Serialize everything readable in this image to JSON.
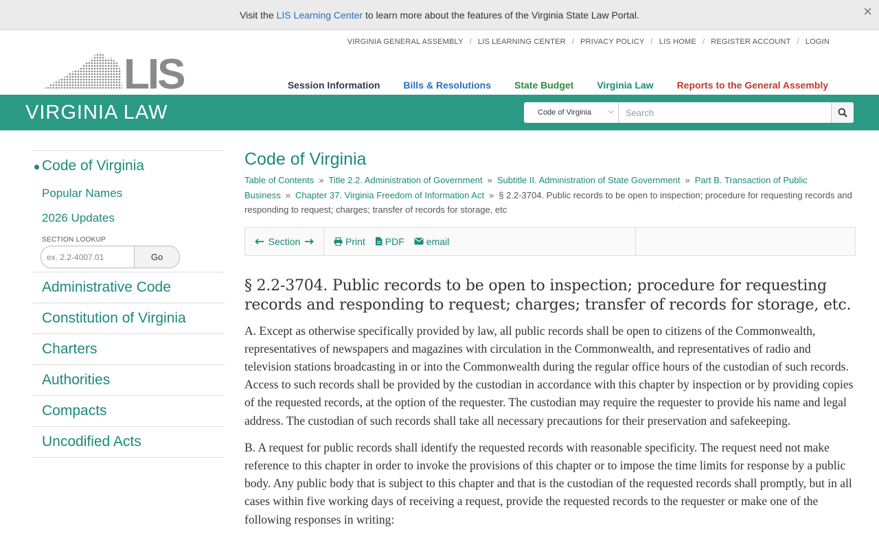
{
  "notice": {
    "prefix": "Visit the",
    "link": "LIS Learning Center",
    "suffix": "to learn more about the features of the Virginia State Law Portal.",
    "close": "×"
  },
  "topnav": [
    "VIRGINIA GENERAL ASSEMBLY",
    "LIS LEARNING CENTER",
    "PRIVACY POLICY",
    "LIS HOME",
    "REGISTER ACCOUNT",
    "LOGIN"
  ],
  "mainnav": {
    "session": "Session Information",
    "bills": "Bills & Resolutions",
    "budget": "State Budget",
    "vlaw": "Virginia Law",
    "reports": "Reports to the General Assembly"
  },
  "banner": {
    "title": "VIRGINIA LAW",
    "select_value": "Code of Virginia",
    "search_placeholder": "Search"
  },
  "sidebar": {
    "active": "Code of Virginia",
    "sub": [
      "Popular Names",
      "2026 Updates"
    ],
    "lookup_label": "SECTION LOOKUP",
    "lookup_placeholder": "ex. 2.2-4007.01",
    "lookup_go": "Go",
    "items": [
      "Administrative Code",
      "Constitution of Virginia",
      "Charters",
      "Authorities",
      "Compacts",
      "Uncodified Acts"
    ]
  },
  "content": {
    "title": "Code of Virginia",
    "breadcrumbs": [
      "Table of Contents",
      "Title 2.2. Administration of Government",
      "Subtitle II. Administration of State Government",
      "Part B. Transaction of Public Business",
      "Chapter 37. Virginia Freedom of Information Act"
    ],
    "current_crumb": "§ 2.2-3704. Public records to be open to inspection; procedure for requesting records and responding to request; charges; transfer of records for storage, etc",
    "toolbar": {
      "section": "Section",
      "print": "Print",
      "pdf": "PDF",
      "email": "email"
    },
    "section_title": "§ 2.2-3704. Public records to be open to inspection; procedure for requesting records and responding to request; charges; transfer of records for storage, etc.",
    "paragraphs": [
      "A. Except as otherwise specifically provided by law, all public records shall be open to citizens of the Commonwealth, representatives of newspapers and magazines with circulation in the Commonwealth, and representatives of radio and television stations broadcasting in or into the Commonwealth during the regular office hours of the custodian of such records. Access to such records shall be provided by the custodian in accordance with this chapter by inspection or by providing copies of the requested records, at the option of the requester. The custodian may require the requester to provide his name and legal address. The custodian of such records shall take all necessary precautions for their preservation and safekeeping.",
      "B. A request for public records shall identify the requested records with reasonable specificity. The request need not make reference to this chapter in order to invoke the provisions of this chapter or to impose the time limits for response by a public body. Any public body that is subject to this chapter and that is the custodian of the requested records shall promptly, but in all cases within five working days of receiving a request, provide the requested records to the requester or make one of the following responses in writing:"
    ]
  },
  "colors": {
    "banner": "#2a9a85",
    "link_green": "#1b8a79",
    "link_blue": "#2a6ebb",
    "budget_green": "#2b8a3e",
    "reports_red": "#c0392b"
  }
}
